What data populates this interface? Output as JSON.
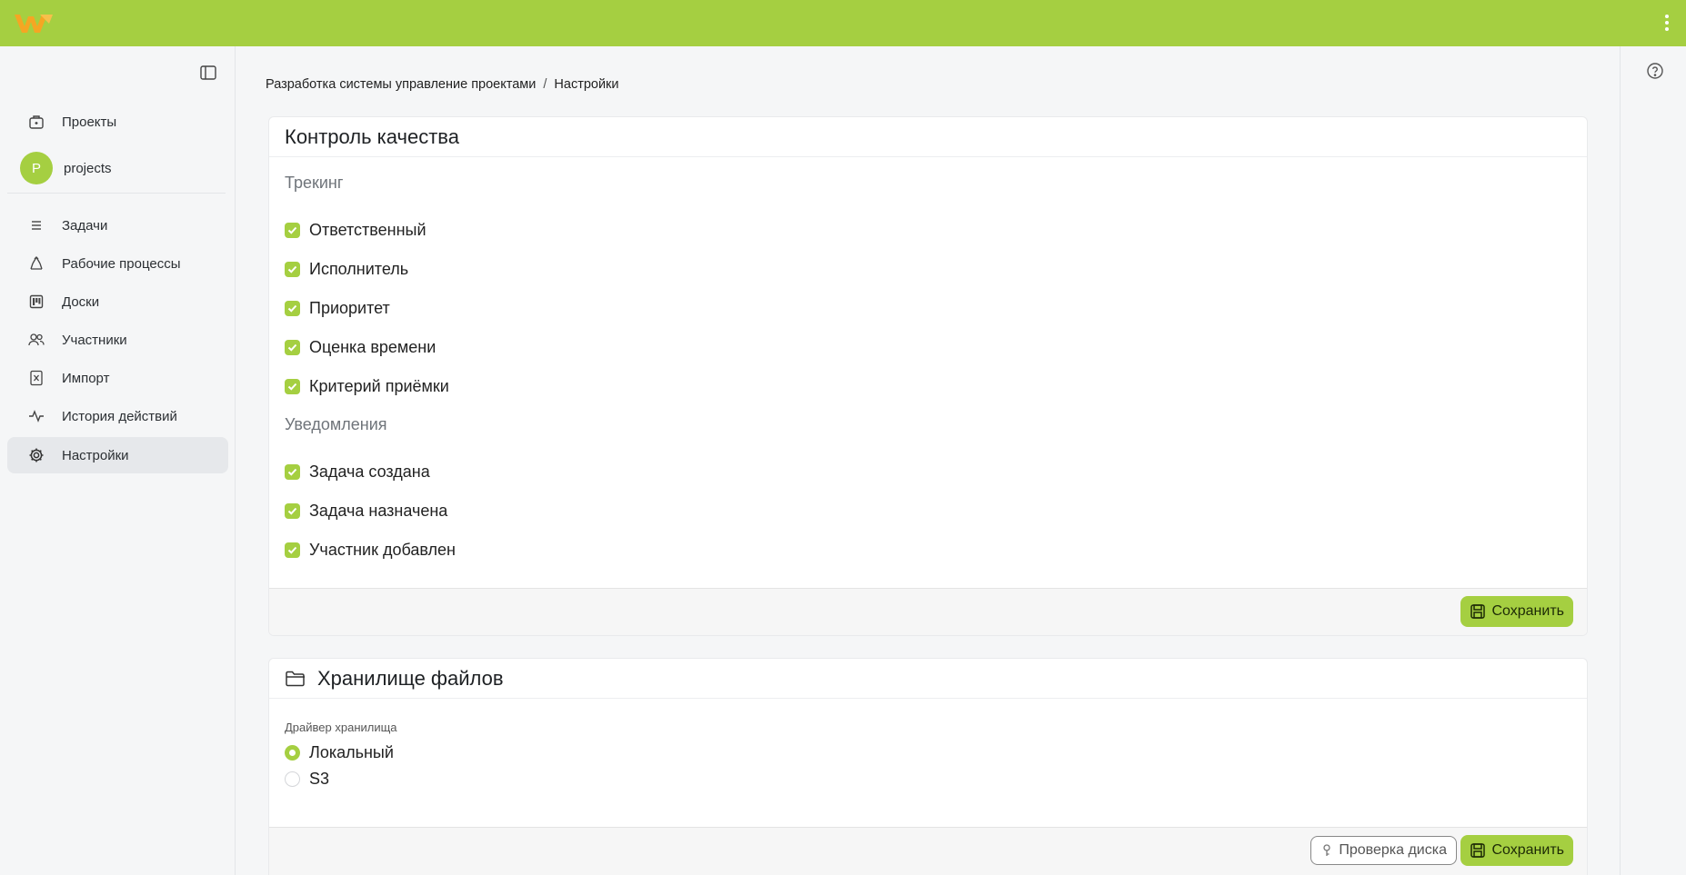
{
  "colors": {
    "accent": "#a5cf41",
    "logo": "#f5a623"
  },
  "topbar": {
    "logo_icon": "app-logo",
    "menu_icon": "kebab-menu-icon"
  },
  "sidebar": {
    "collapse_icon": "sidebar-toggle-icon",
    "projects_label": "Проекты",
    "project": {
      "avatar_letter": "P",
      "name": "projects"
    },
    "items": [
      {
        "label": "Задачи",
        "icon": "list-icon"
      },
      {
        "label": "Рабочие процессы",
        "icon": "workflow-icon"
      },
      {
        "label": "Доски",
        "icon": "board-icon"
      },
      {
        "label": "Участники",
        "icon": "users-icon"
      },
      {
        "label": "Импорт",
        "icon": "import-icon"
      },
      {
        "label": "История действий",
        "icon": "activity-icon"
      },
      {
        "label": "Настройки",
        "icon": "gear-icon",
        "active": true
      }
    ]
  },
  "breadcrumb": {
    "project": "Разработка системы управление проектами",
    "separator": "/",
    "current": "Настройки"
  },
  "quality": {
    "title": "Контроль качества",
    "tracking_title": "Трекинг",
    "tracking": [
      {
        "label": "Ответственный",
        "checked": true
      },
      {
        "label": "Исполнитель",
        "checked": true
      },
      {
        "label": "Приоритет",
        "checked": true
      },
      {
        "label": "Оценка времени",
        "checked": true
      },
      {
        "label": "Критерий приёмки",
        "checked": true
      }
    ],
    "notifications_title": "Уведомления",
    "notifications": [
      {
        "label": "Задача создана",
        "checked": true
      },
      {
        "label": "Задача назначена",
        "checked": true
      },
      {
        "label": "Участник добавлен",
        "checked": true
      }
    ],
    "save_label": "Сохранить"
  },
  "storage": {
    "title": "Хранилище файлов",
    "driver_label": "Драйвер хранилища",
    "options": [
      {
        "label": "Локальный",
        "selected": true
      },
      {
        "label": "S3",
        "selected": false
      }
    ],
    "check_label": "Проверка диска",
    "save_label": "Сохранить"
  }
}
